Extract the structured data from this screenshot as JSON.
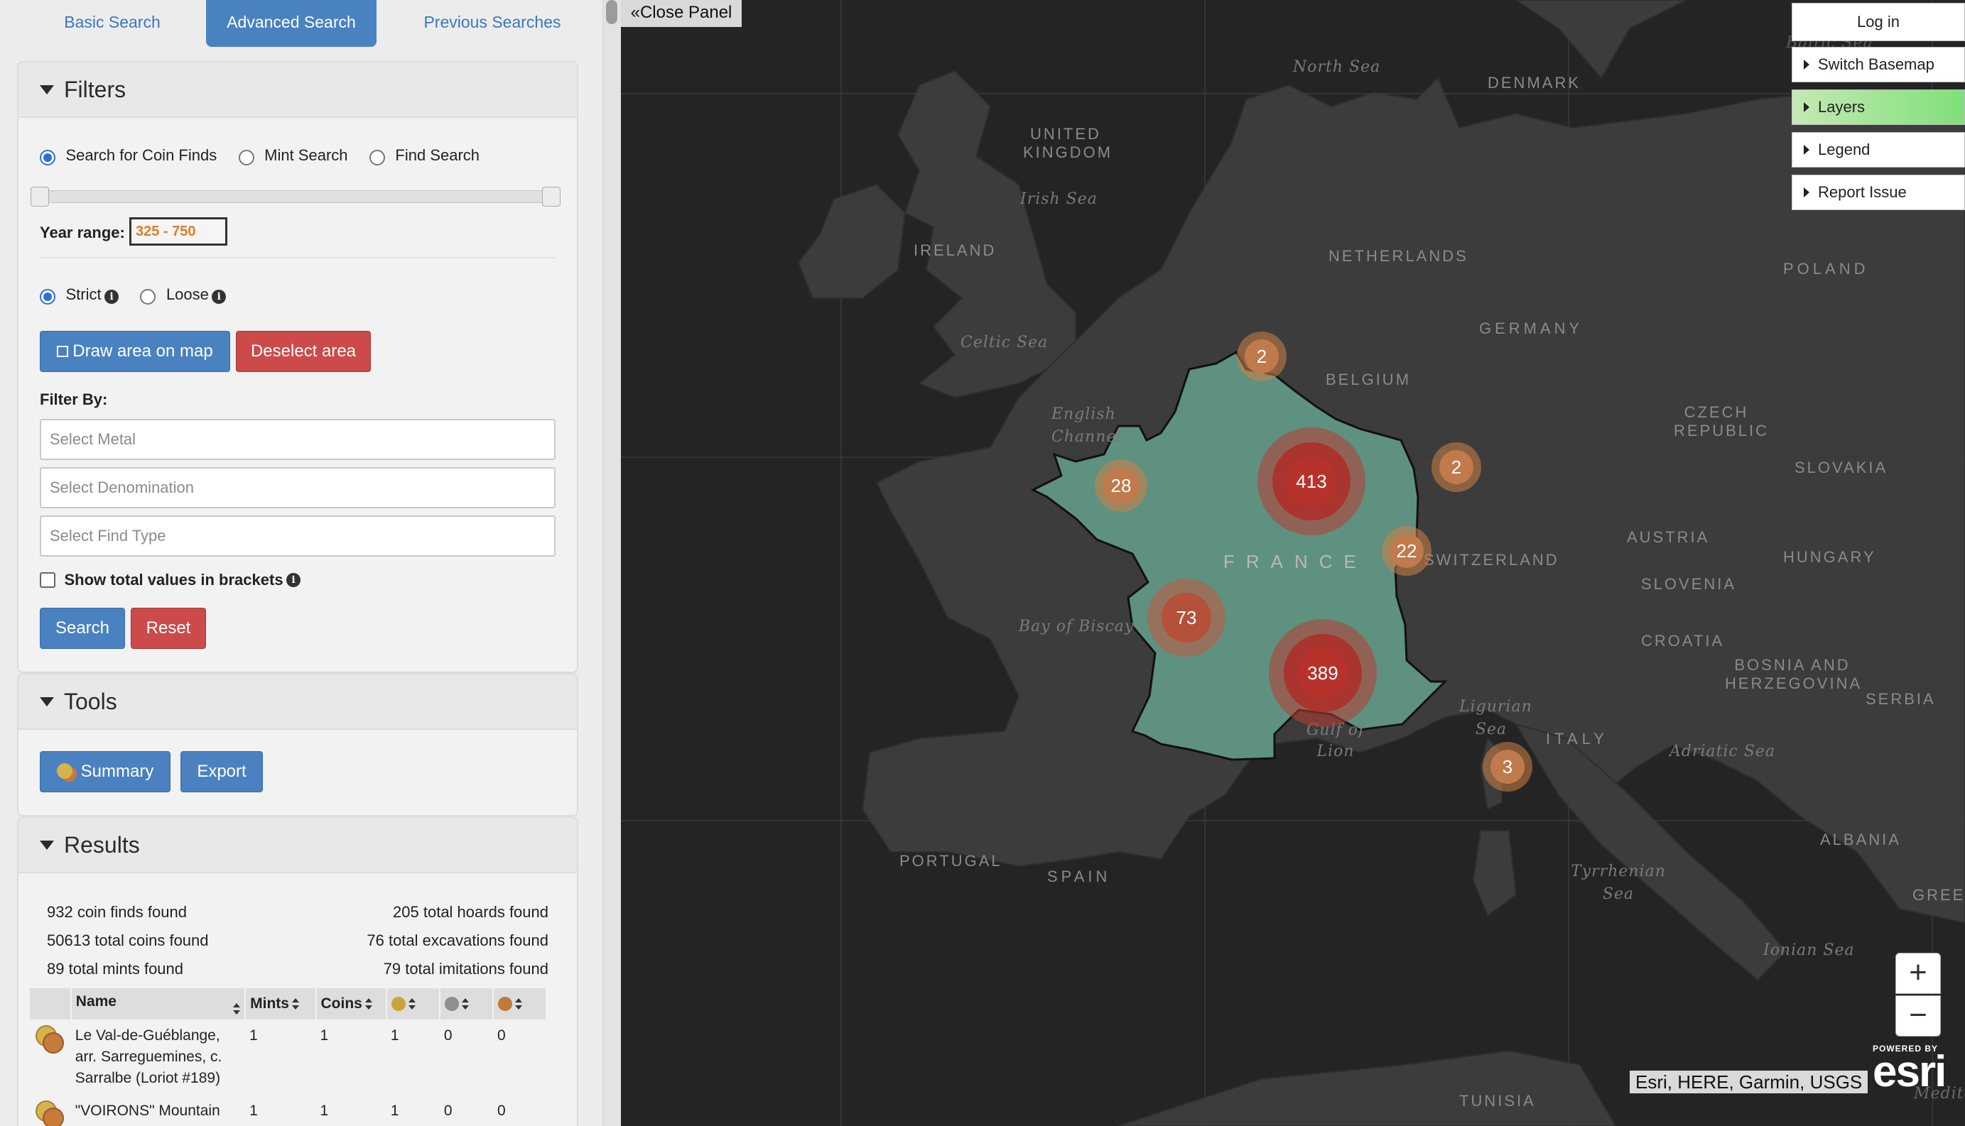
{
  "tabs": [
    "Basic Search",
    "Advanced Search",
    "Previous Searches"
  ],
  "filters": {
    "title": "Filters",
    "search_modes": [
      "Search for Coin Finds",
      "Mint Search",
      "Find Search"
    ],
    "year_range_label": "Year range:",
    "year_range_value": "325 - 750",
    "strict_label": "Strict",
    "loose_label": "Loose",
    "draw_area_label": "Draw area on map",
    "deselect_area_label": "Deselect area",
    "filter_by_label": "Filter By:",
    "metal_placeholder": "Select Metal",
    "denomination_placeholder": "Select Denomination",
    "find_type_placeholder": "Select Find Type",
    "show_totals_label": "Show total values in brackets",
    "search_label": "Search",
    "reset_label": "Reset"
  },
  "tools": {
    "title": "Tools",
    "summary_label": "Summary",
    "export_label": "Export"
  },
  "results": {
    "title": "Results",
    "stats_left": [
      "932 coin finds found",
      "50613 total coins found",
      "89 total mints found"
    ],
    "stats_right": [
      "205 total hoards found",
      "76 total excavations found",
      "79 total imitations found"
    ],
    "columns": [
      "Name",
      "Mints",
      "Coins"
    ],
    "metal_dot_colors": [
      "#c9a43a",
      "#8f8f8f",
      "#c07a3a"
    ],
    "rows": [
      {
        "name": "Le Val-de-Guéblange, arr. Sarreguemines, c. Sarralbe (Loriot #189)",
        "mints": "1",
        "coins": "1",
        "gold": "1",
        "silver": "0",
        "bronze": "0"
      },
      {
        "name": "\"VOIRONS\" Mountain",
        "mints": "1",
        "coins": "1",
        "gold": "1",
        "silver": "0",
        "bronze": "0"
      }
    ]
  },
  "map": {
    "close_panel": "«Close Panel",
    "menu": [
      "Log in",
      "Switch Basemap",
      "Layers",
      "Legend",
      "Report Issue"
    ],
    "zoom_in": "+",
    "zoom_out": "−",
    "attribution": "Esri, HERE, Garmin, USGS",
    "esri_powered": "POWERED BY",
    "esri_logo": "esri",
    "labels": {
      "north_sea": "North Sea",
      "denmark": "DENMARK",
      "united_kingdom": "UNITED KINGDOM",
      "irish_sea": "Irish Sea",
      "ireland": "IRELAND",
      "netherlands": "NETHERLANDS",
      "germany": "GERMANY",
      "poland": "POLAND",
      "celtic_sea": "Celtic Sea",
      "belgium": "BELGIUM",
      "english_channel": "English Channel",
      "czech_republic": "CZECH REPUBLIC",
      "slovakia": "SLOVAKIA",
      "austria": "AUSTRIA",
      "hungary": "HUNGARY",
      "france": "FRANCE",
      "switzerland": "SWITZERLAND",
      "slovenia": "SLOVENIA",
      "croatia": "CROATIA",
      "bay_of_biscay": "Bay of Biscay",
      "bosnia": "BOSNIA AND HERZEGOVINA",
      "serbia": "SERBIA",
      "ligurian_sea": "Ligurian Sea",
      "italy": "ITALY",
      "adriatic_sea": "Adriatic Sea",
      "gulf_of_lion": "Gulf of Lion",
      "portugal": "PORTUGAL",
      "spain": "SPAIN",
      "tyrrhenian_sea": "Tyrrhenian Sea",
      "albania": "ALBANIA",
      "greece": "GREECE",
      "ionian_sea": "Ionian Sea",
      "tunisia": "TUNISIA",
      "baltic_sea": "Baltic Sea",
      "mediterranean": "Medite"
    },
    "clusters": [
      "2",
      "28",
      "413",
      "2",
      "22",
      "73",
      "389",
      "3"
    ]
  }
}
